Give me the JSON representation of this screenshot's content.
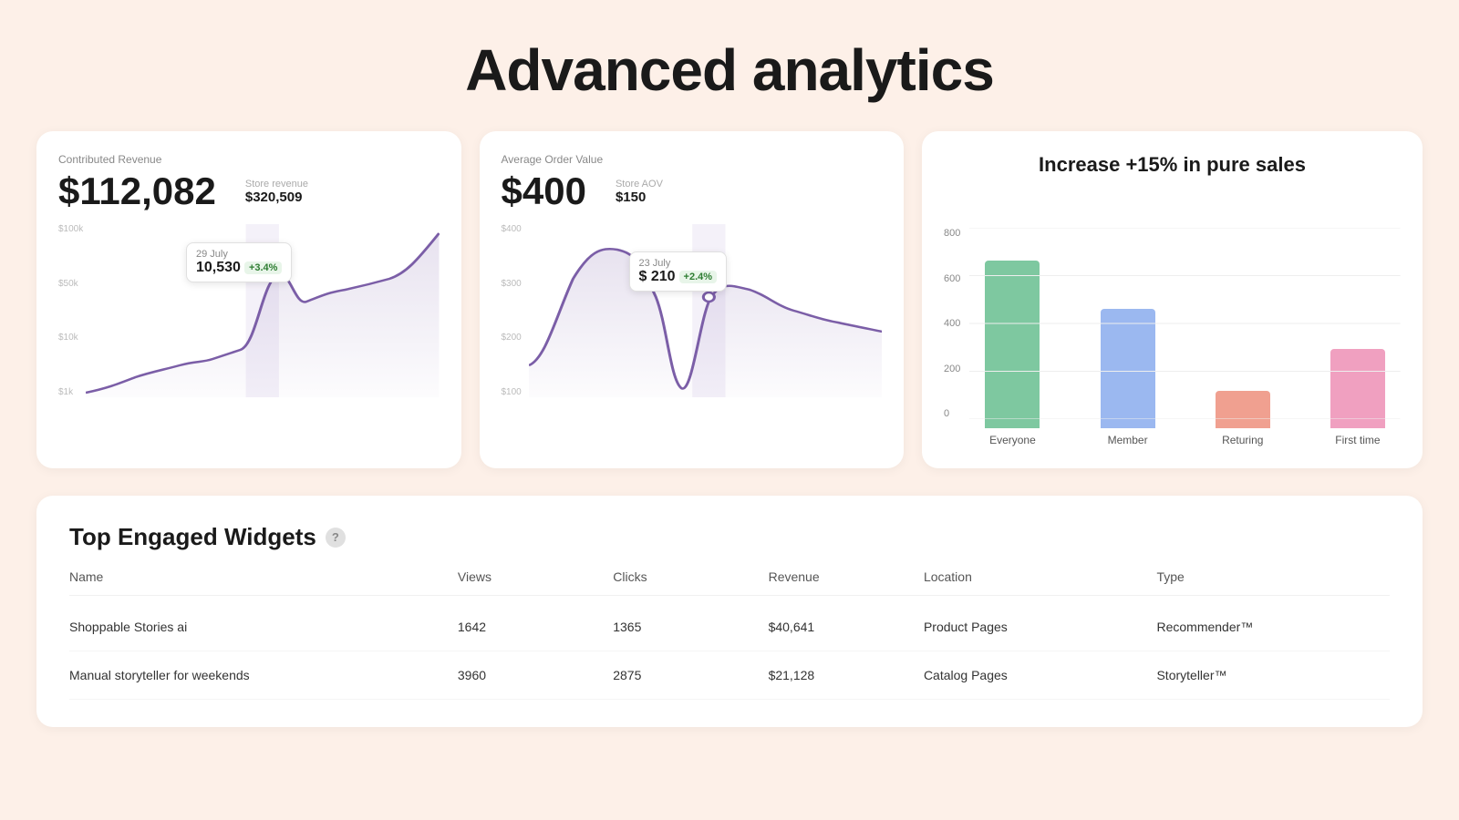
{
  "page": {
    "title": "Advanced analytics",
    "background": "#fdf0e8"
  },
  "revenue_card": {
    "label": "Contributed Revenue",
    "main_value": "$112,082",
    "store_label": "Store revenue",
    "store_value": "$320,509",
    "y_labels": [
      "$100k",
      "$50k",
      "$10k",
      "$1k"
    ],
    "tooltip": {
      "date": "29 July",
      "value": "10,530",
      "badge": "+3.4%"
    }
  },
  "aov_card": {
    "label": "Average Order Value",
    "main_value": "$400",
    "store_label": "Store AOV",
    "store_value": "$150",
    "y_labels": [
      "$400",
      "$300",
      "$200",
      "$100"
    ],
    "tooltip": {
      "date": "23 July",
      "value": "$ 210",
      "badge": "+2.4%"
    }
  },
  "bar_chart": {
    "title": "Increase +15% in pure sales",
    "y_labels": [
      "0",
      "200",
      "400",
      "600",
      "800"
    ],
    "bars": [
      {
        "label": "Everyone",
        "value": 700,
        "color": "#7ec8a0"
      },
      {
        "label": "Member",
        "value": 500,
        "color": "#9bb8f0"
      },
      {
        "label": "Returing",
        "value": 155,
        "color": "#f0a090"
      },
      {
        "label": "First time",
        "value": 330,
        "color": "#f0a0c0"
      }
    ],
    "max_value": 800
  },
  "widgets_table": {
    "title": "Top Engaged Widgets",
    "help_icon": "?",
    "columns": [
      "Name",
      "Views",
      "Clicks",
      "Revenue",
      "Location",
      "Type"
    ],
    "rows": [
      {
        "name": "Shoppable Stories ai",
        "views": "1642",
        "clicks": "1365",
        "revenue": "$40,641",
        "location": "Product Pages",
        "type": "Recommender™"
      },
      {
        "name": "Manual storyteller for weekends",
        "views": "3960",
        "clicks": "2875",
        "revenue": "$21,128",
        "location": "Catalog Pages",
        "type": "Storyteller™"
      }
    ]
  }
}
